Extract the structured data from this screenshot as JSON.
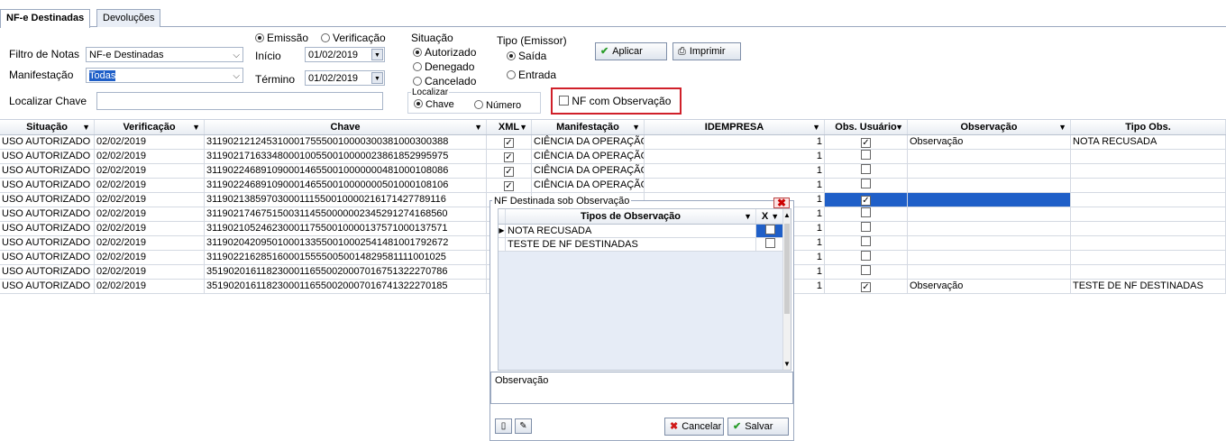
{
  "tabs": [
    {
      "label": "NF-e Destinadas",
      "active": true
    },
    {
      "label": "Devoluções",
      "active": false
    }
  ],
  "filters": {
    "filtro_label": "Filtro de Notas",
    "filtro_value": "NF-e Destinadas",
    "manifestacao_label": "Manifestação",
    "manifestacao_value": "Todas",
    "localizar_label": "Localizar Chave",
    "localizar_value": "",
    "emissao_label": "Emissão",
    "verificacao_label": "Verificação",
    "inicio_label": "Início",
    "inicio_value": "01/02/2019",
    "termino_label": "Término",
    "termino_value": "01/02/2019",
    "situacao_title": "Situação",
    "situacao_options": [
      "Autorizado",
      "Denegado",
      "Cancelado"
    ],
    "tipo_title": "Tipo (Emissor)",
    "tipo_options": [
      "Saída",
      "Entrada"
    ],
    "localizar_group_title": "Localizar",
    "localizar_chave": "Chave",
    "localizar_numero": "Número",
    "nf_obs_label": "NF com Observação",
    "aplicar_label": "Aplicar",
    "imprimir_label": "Imprimir"
  },
  "grid": {
    "columns": [
      "Situação",
      "Verificação",
      "Chave",
      "XML",
      "Manifestação",
      "IDEMPRESA",
      "Obs. Usuário",
      "Observação",
      "Tipo Obs."
    ],
    "rows": [
      {
        "situacao": "USO AUTORIZADO",
        "verificacao": "02/02/2019",
        "chave": "31190212124531000175550010000300381000300388",
        "xml": true,
        "manifestacao": "CIÊNCIA DA OPERAÇÃO",
        "idempresa": "1",
        "obs_usuario": true,
        "observacao": "Observação",
        "tipo_obs": "NOTA RECUSADA"
      },
      {
        "situacao": "USO AUTORIZADO",
        "verificacao": "02/02/2019",
        "chave": "31190217163348000100550010000023861852995975",
        "xml": true,
        "manifestacao": "CIÊNCIA DA OPERAÇÃO",
        "idempresa": "1",
        "obs_usuario": false,
        "observacao": "",
        "tipo_obs": ""
      },
      {
        "situacao": "USO AUTORIZADO",
        "verificacao": "02/02/2019",
        "chave": "31190224689109000146550010000000481000108086",
        "xml": true,
        "manifestacao": "CIÊNCIA DA OPERAÇÃO",
        "idempresa": "1",
        "obs_usuario": false,
        "observacao": "",
        "tipo_obs": ""
      },
      {
        "situacao": "USO AUTORIZADO",
        "verificacao": "02/02/2019",
        "chave": "31190224689109000146550010000000501000108106",
        "xml": true,
        "manifestacao": "CIÊNCIA DA OPERAÇÃO",
        "idempresa": "1",
        "obs_usuario": false,
        "observacao": "",
        "tipo_obs": ""
      },
      {
        "situacao": "USO AUTORIZADO",
        "verificacao": "02/02/2019",
        "chave": "31190213859703000111550010000216171427789116",
        "xml": true,
        "manifestacao": "",
        "idempresa": "1",
        "obs_usuario": true,
        "observacao": "",
        "tipo_obs": "",
        "selected": true
      },
      {
        "situacao": "USO AUTORIZADO",
        "verificacao": "02/02/2019",
        "chave": "31190217467515003114550000002345291274168560",
        "xml": false,
        "manifestacao": "",
        "idempresa": "1",
        "obs_usuario": false,
        "observacao": "",
        "tipo_obs": ""
      },
      {
        "situacao": "USO AUTORIZADO",
        "verificacao": "02/02/2019",
        "chave": "31190210524623000117550010000137571000137571",
        "xml": false,
        "manifestacao": "",
        "idempresa": "1",
        "obs_usuario": false,
        "observacao": "",
        "tipo_obs": ""
      },
      {
        "situacao": "USO AUTORIZADO",
        "verificacao": "02/02/2019",
        "chave": "31190204209501000133550010002541481001792672",
        "xml": false,
        "manifestacao": "",
        "idempresa": "1",
        "obs_usuario": false,
        "observacao": "",
        "tipo_obs": ""
      },
      {
        "situacao": "USO AUTORIZADO",
        "verificacao": "02/02/2019",
        "chave": "31190221628516000155550050014829581111001025",
        "xml": false,
        "manifestacao": "",
        "idempresa": "1",
        "obs_usuario": false,
        "observacao": "",
        "tipo_obs": ""
      },
      {
        "situacao": "USO AUTORIZADO",
        "verificacao": "02/02/2019",
        "chave": "35190201611823000116550020007016751322270786",
        "xml": false,
        "manifestacao": "",
        "idempresa": "1",
        "obs_usuario": false,
        "observacao": "",
        "tipo_obs": ""
      },
      {
        "situacao": "USO AUTORIZADO",
        "verificacao": "02/02/2019",
        "chave": "35190201611823000116550020007016741322270185",
        "xml": false,
        "manifestacao": "",
        "idempresa": "1",
        "obs_usuario": true,
        "observacao": "Observação",
        "tipo_obs": "TESTE DE NF DESTINADAS"
      }
    ]
  },
  "dialog": {
    "title": "NF Destinada sob Observação",
    "col_tipos": "Tipos de Observação",
    "col_x": "X",
    "items": [
      "NOTA RECUSADA",
      "TESTE DE NF DESTINADAS"
    ],
    "obs_label": "Observação",
    "cancelar_label": "Cancelar",
    "salvar_label": "Salvar"
  },
  "colors": {
    "selected_row": "#1f5fc8",
    "highlight_border": "#d0202a",
    "accent_check": "#2a9d2a"
  }
}
